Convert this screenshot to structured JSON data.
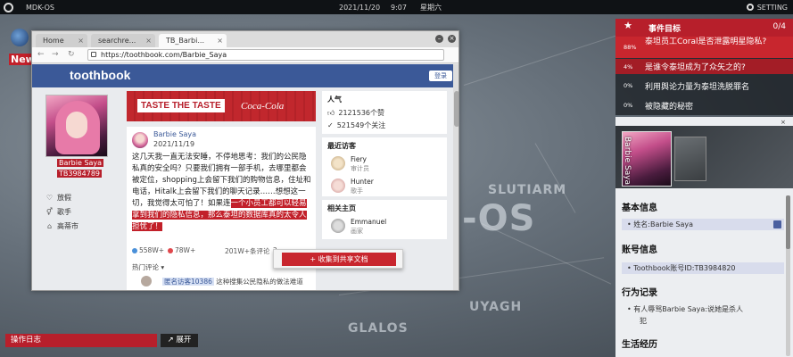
{
  "topbar": {
    "os_name": "MDK-OS",
    "date": "2021/11/20",
    "time": "9:07",
    "weekday": "星期六",
    "setting": "SETTING"
  },
  "news_label": "New",
  "map_labels": [
    "SLUTIARM",
    "-OS",
    "UYAGH",
    "GLALOS"
  ],
  "browser": {
    "tabs": [
      {
        "label": "Home",
        "active": false
      },
      {
        "label": "searchre...",
        "active": false
      },
      {
        "label": "TB_Barbi...",
        "active": true
      }
    ],
    "tab_close": "×",
    "url": "https://toothbook.com/Barbie_Saya",
    "site": {
      "brand": "toothbook",
      "login": "登录",
      "profile": {
        "name": "Barbie Saya",
        "id": "TB3984789",
        "info": [
          {
            "icon": "heart-icon",
            "glyph": "♡",
            "label": "放假"
          },
          {
            "icon": "person-icon",
            "glyph": "⚥",
            "label": "歌手"
          },
          {
            "icon": "location-icon",
            "glyph": "⌂",
            "label": "高蒂市"
          }
        ]
      },
      "banner": {
        "text": "TASTE THE TASTE",
        "logo": "Coca-Cola"
      },
      "post": {
        "author": "Barbie Saya",
        "date": "2021/11/19",
        "body_plain": "这几天我一直无法安睡，不停地思考：我们的公民隐私真的安全吗？只要我们拥有一部手机，去哪里都会被定位，shopping上会留下我们的购物信息，住址和电话，Hitalk上会留下我们的聊天记录……想想这一切，我觉得太可怕了！如果连",
        "body_highlight": "一个小员工都可以轻易拿到我们的隐私信息，那么泰坦的数据库真的太令人担忧了！",
        "stats": {
          "likes": "558W+",
          "hearts": "78W+",
          "comments": "201W+条评论",
          "shares": "2..."
        },
        "hot_comments": "热门评论",
        "comment_user": "匿名访客10386",
        "comment_text": "这种搜集公民隐私的做法难道"
      },
      "context_menu": "+ 收集到共享文档",
      "popularity": {
        "title": "人气",
        "likes": "2121536个赞",
        "followers": "521549个关注"
      },
      "recent_visitors": {
        "title": "最近访客",
        "items": [
          {
            "name": "Fiery",
            "role": "审计员"
          },
          {
            "name": "Hunter",
            "role": "歌手"
          }
        ]
      },
      "related": {
        "title": "相关主页",
        "items": [
          {
            "name": "Emmanuel",
            "role": "画家"
          }
        ]
      }
    }
  },
  "events": {
    "title": "事件目标",
    "count": "0/4",
    "items": [
      {
        "pct": "88%",
        "text": "泰坦员工Coral是否泄露明星隐私?",
        "value": 88,
        "active": true
      },
      {
        "pct": "4%",
        "text": "是谁令泰坦成为了众矢之的?",
        "value": 4,
        "active": true
      },
      {
        "pct": "0%",
        "text": "利用舆论力量为泰坦洗脱罪名",
        "value": 0,
        "active": false
      },
      {
        "pct": "0%",
        "text": "被隐藏的秘密",
        "value": 0,
        "active": false
      }
    ]
  },
  "profile_card": {
    "cover_name": "Barbie Saya",
    "close": "×",
    "sections": [
      {
        "title": "基本信息",
        "rows": [
          "• 姓名:Barbie Saya"
        ]
      },
      {
        "title": "账号信息",
        "rows": [
          "• Toothbook账号ID:TB3984820"
        ]
      },
      {
        "title": "行为记录",
        "rows": [
          "• 有人辱骂Barbie Saya:说她是杀人",
          "犯"
        ]
      },
      {
        "title": "生活经历",
        "rows": []
      }
    ]
  },
  "bottom": {
    "log": "操作日志",
    "expand": "↗ 展开"
  },
  "colors": {
    "accent_red": "#b71f2b",
    "fb_blue": "#3b5998"
  }
}
